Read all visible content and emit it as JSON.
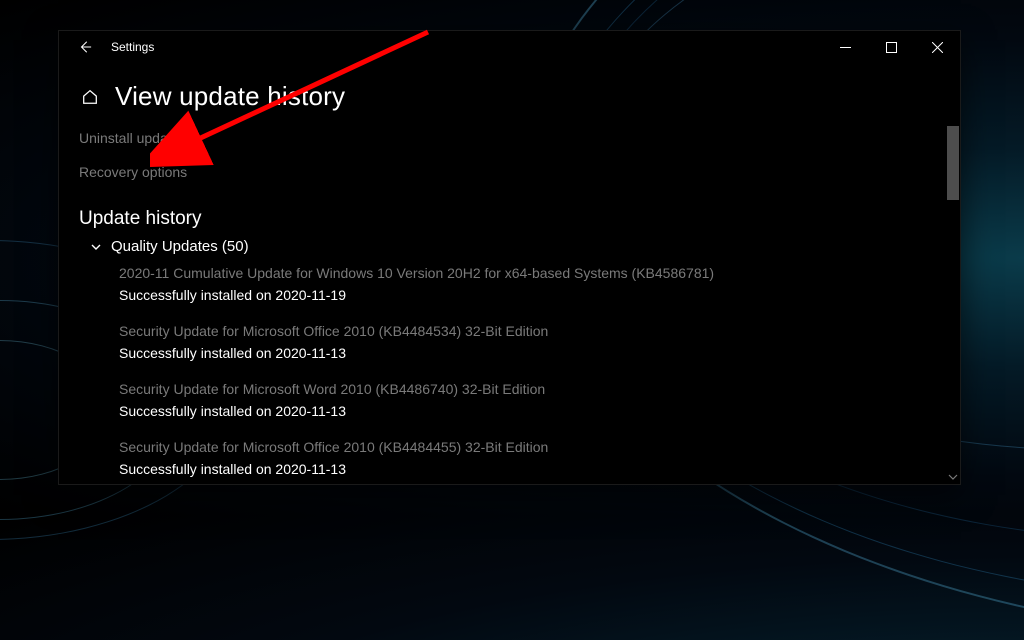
{
  "titlebar": {
    "app_name": "Settings"
  },
  "header": {
    "page_title": "View update history"
  },
  "links": {
    "uninstall": "Uninstall updates",
    "recovery": "Recovery options"
  },
  "section": {
    "history_title": "Update history"
  },
  "group": {
    "quality_label": "Quality Updates (50)"
  },
  "updates": [
    {
      "title": "2020-11 Cumulative Update for Windows 10 Version 20H2 for x64-based Systems (KB4586781)",
      "status": "Successfully installed on 2020-11-19"
    },
    {
      "title": "Security Update for Microsoft Office 2010 (KB4484534) 32-Bit Edition",
      "status": "Successfully installed on 2020-11-13"
    },
    {
      "title": "Security Update for Microsoft Word 2010 (KB4486740) 32-Bit Edition",
      "status": "Successfully installed on 2020-11-13"
    },
    {
      "title": "Security Update for Microsoft Office 2010 (KB4484455) 32-Bit Edition",
      "status": "Successfully installed on 2020-11-13"
    }
  ]
}
